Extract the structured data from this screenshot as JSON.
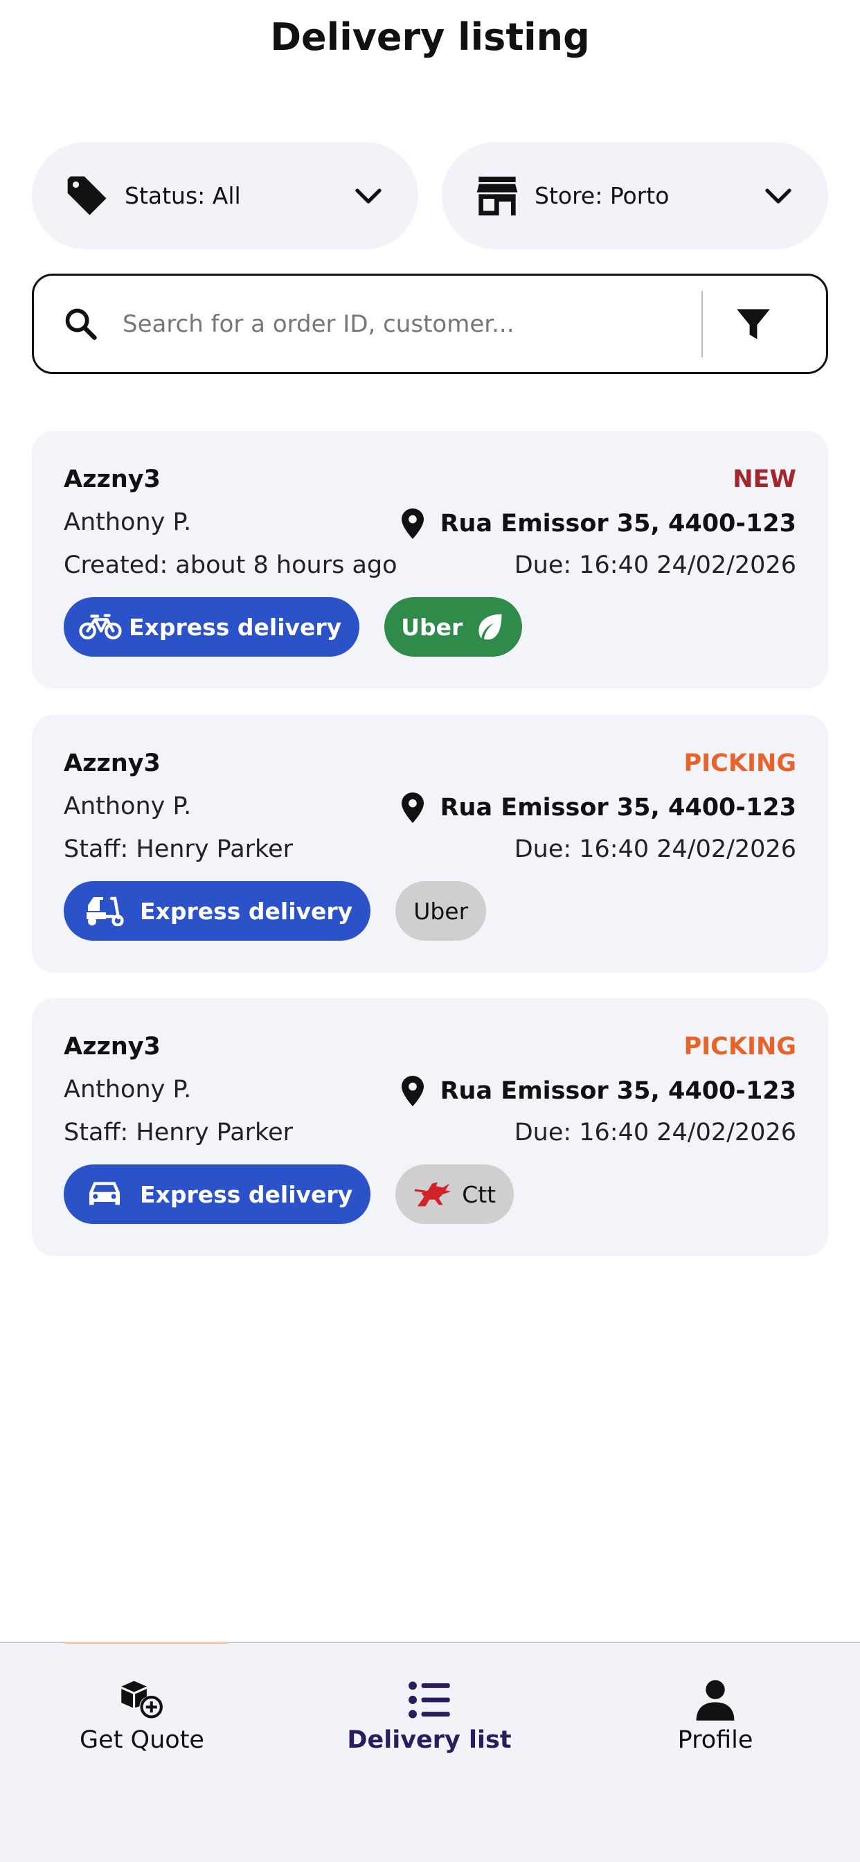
{
  "header": {
    "title": "Delivery listing"
  },
  "filters": {
    "status_label": "Status: All",
    "store_label": "Store: Porto"
  },
  "search": {
    "placeholder": "Search for a order ID, customer..."
  },
  "orders": [
    {
      "brand": "Azzny3",
      "status": "NEW",
      "status_color": "#a3262a",
      "customer": "Anthony P.",
      "address": "Rua Emissor 35, 4400-123",
      "meta": "Created: about 8 hours ago",
      "due": "Due: 16:40 24/02/2026",
      "delivery_type": "Express delivery",
      "delivery_icon": "bicycle-icon",
      "provider": "Uber",
      "provider_icon": "leaf-icon"
    },
    {
      "brand": "Azzny3",
      "status": "PICKING",
      "status_color": "#e8632a",
      "customer": "Anthony P.",
      "address": "Rua Emissor 35, 4400-123",
      "meta": "Staff: Henry Parker",
      "due": "Due: 16:40 24/02/2026",
      "delivery_type": "Express delivery",
      "delivery_icon": "scooter-icon",
      "provider": "Uber"
    },
    {
      "brand": "Azzny3",
      "status": "PICKING",
      "status_color": "#e8632a",
      "customer": "Anthony P.",
      "address": "Rua Emissor 35, 4400-123",
      "meta": "Staff: Henry Parker",
      "due": "Due: 16:40 24/02/2026",
      "delivery_type": "Express delivery",
      "delivery_icon": "car-icon",
      "provider": "Ctt",
      "provider_icon": "ctt-horse-icon"
    }
  ],
  "nav": {
    "items": [
      {
        "label": "Get Quote",
        "icon": "box-plus-icon"
      },
      {
        "label": "Delivery list",
        "icon": "list-icon",
        "active": true
      },
      {
        "label": "Profile",
        "icon": "user-icon"
      }
    ]
  },
  "colors": {
    "accent_blue": "#2b52c9",
    "uber_green": "#2f8b4a",
    "card_bg": "#f3f3fa",
    "active_nav": "#2b1d5c"
  }
}
